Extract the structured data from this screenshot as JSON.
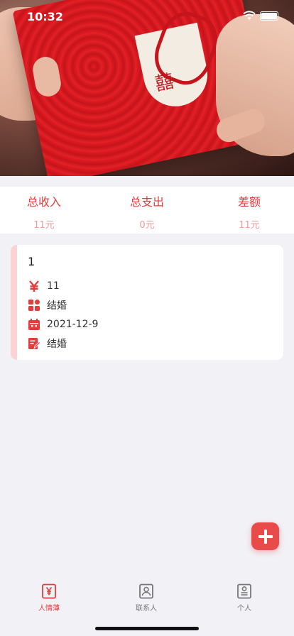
{
  "status_bar": {
    "time": "10:32"
  },
  "banner": {
    "decor": "红包"
  },
  "summary": [
    {
      "label": "总收入",
      "value": "11元"
    },
    {
      "label": "总支出",
      "value": "0元"
    },
    {
      "label": "差额",
      "value": "11元"
    }
  ],
  "records": [
    {
      "title": "1",
      "amount": "11",
      "category": "结婚",
      "date": "2021-12-9",
      "note": "结婚"
    }
  ],
  "icons": {
    "amount": "yen-icon",
    "category": "category-grid-icon",
    "date": "calendar-icon",
    "note": "edit-note-icon",
    "add": "plus-icon"
  },
  "colors": {
    "accent": "#e53b3b",
    "accent_light": "#f29a9a",
    "stripe": "#fcd3d3"
  },
  "tabs": [
    {
      "label": "人情薄",
      "active": true
    },
    {
      "label": "联系人",
      "active": false
    },
    {
      "label": "个人",
      "active": false
    }
  ]
}
